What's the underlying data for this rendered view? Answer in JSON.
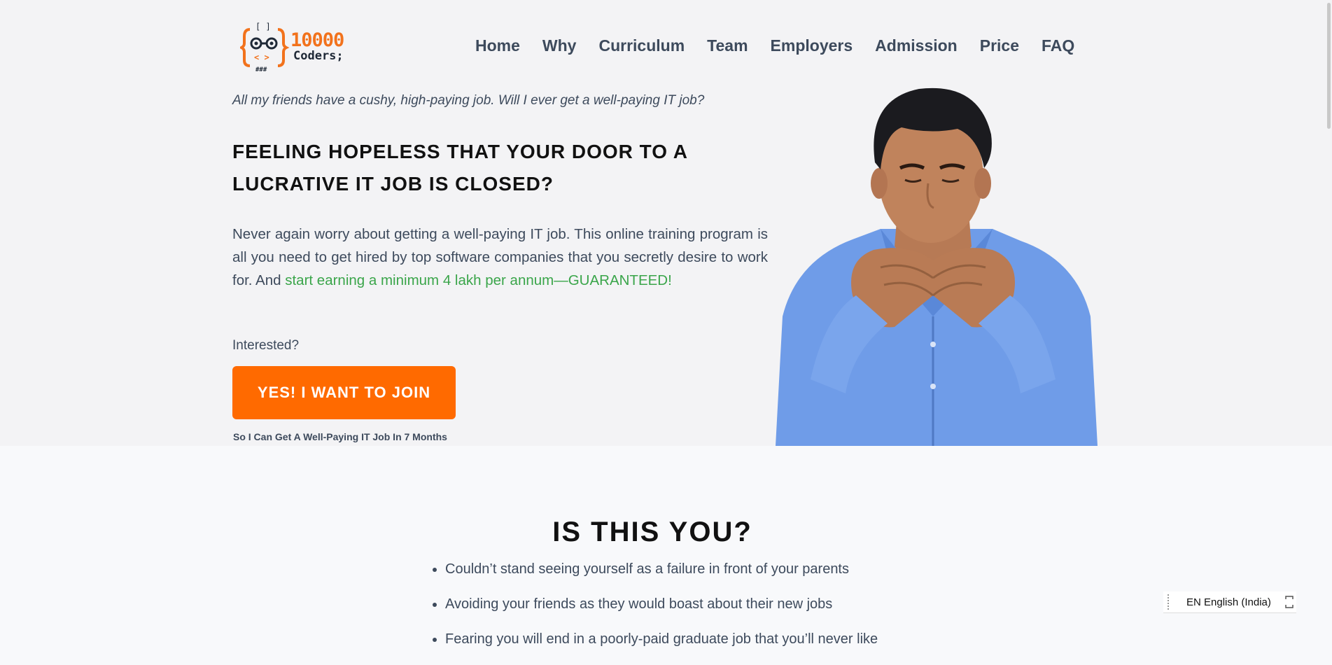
{
  "brand": {
    "logo_line1": "10000",
    "logo_line2": "Coders;",
    "logo_marks": "[ ]",
    "logo_glyph": "< >",
    "logo_hash": "###",
    "accent_color": "#f2721c"
  },
  "nav": {
    "items": [
      "Home",
      "Why",
      "Curriculum",
      "Team",
      "Employers",
      "Admission",
      "Price",
      "FAQ"
    ]
  },
  "hero": {
    "subquote": "All my friends have a cushy, high-paying job. Will I ever get a well-paying IT job?",
    "headline": "FEELING HOPELESS THAT YOUR DOOR TO A LUCRATIVE IT JOB IS CLOSED?",
    "lead_text": "Never again worry about getting a well-paying IT job. This online training program is all you need to get hired by top software companies that you secretly desire to work for. And ",
    "lead_highlight": "start earning a minimum 4 lakh per annum—GUARANTEED!",
    "interested": "Interested?",
    "cta_label": "YES! I WANT TO JOIN",
    "cta_note": "So I Can Get A Well-Paying IT Job In 7 Months",
    "cta_color": "#ff6a00",
    "highlight_color": "#3aa54a"
  },
  "pain_section": {
    "title": "IS THIS YOU?",
    "items": [
      "Couldn’t stand seeing yourself as a failure in front of your parents",
      "Avoiding your friends as they would boast about their new jobs",
      "Fearing you will end in a poorly-paid graduate job that you’ll never like"
    ]
  },
  "language_widget": {
    "label": "EN English (India)"
  }
}
